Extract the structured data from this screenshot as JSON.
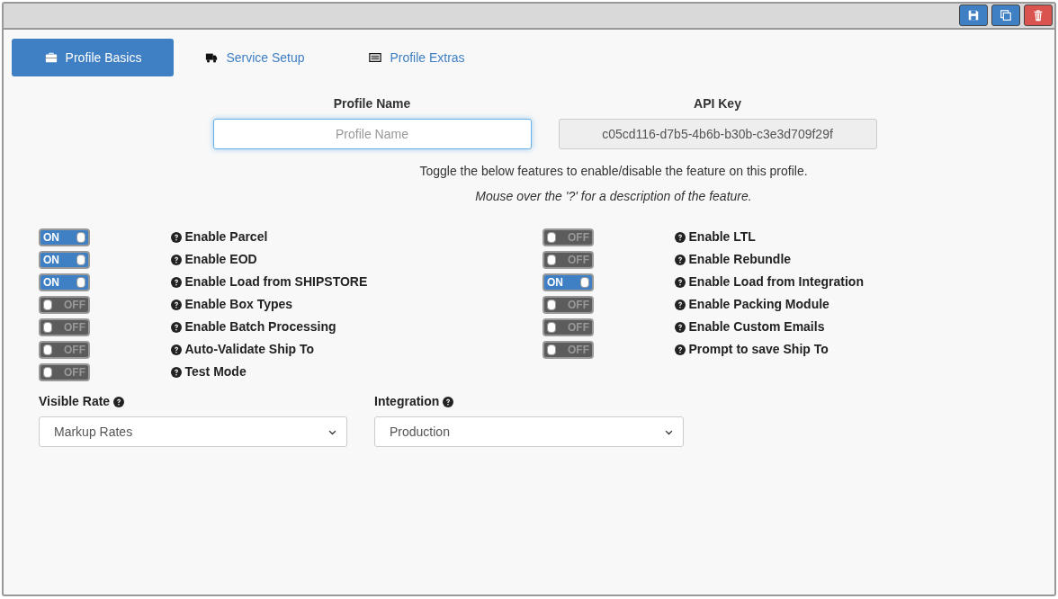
{
  "toolbar": {
    "buttons": [
      {
        "kind": "save",
        "color": "#3f7fc4"
      },
      {
        "kind": "copy",
        "color": "#3f7fc4"
      },
      {
        "kind": "delete",
        "color": "#d9534f"
      }
    ]
  },
  "tabs": [
    {
      "label": "Profile Basics",
      "kind": "basics",
      "selected": true
    },
    {
      "label": "Service Setup",
      "kind": "service",
      "selected": false
    },
    {
      "label": "Profile Extras",
      "kind": "extras",
      "selected": false
    }
  ],
  "profile_name": {
    "label": "Profile Name",
    "placeholder": "Profile Name",
    "focused": true
  },
  "api_key": {
    "label": "API Key",
    "value": "c05cd116-d7b5-4b6b-b30b-c3e3d709f29f",
    "disabled": true
  },
  "intro": "Toggle the below features to enable/disable the feature on this profile.",
  "hint": "Mouse over the '?' for a description of the feature.",
  "features_left": [
    {
      "label": "Enable Parcel",
      "on": true,
      "text": "ON"
    },
    {
      "label": "Enable EOD",
      "on": true,
      "text": "ON"
    },
    {
      "label": "Enable Load from SHIPSTORE",
      "on": true,
      "text": "ON"
    },
    {
      "label": "Enable Box Types",
      "on": false,
      "text": "OFF"
    },
    {
      "label": "Enable Batch Processing",
      "on": false,
      "text": "OFF"
    },
    {
      "label": "Auto-Validate Ship To",
      "on": false,
      "text": "OFF"
    },
    {
      "label": "Test Mode",
      "on": false,
      "text": "OFF"
    }
  ],
  "features_right": [
    {
      "label": "Enable LTL",
      "on": false,
      "text": "OFF"
    },
    {
      "label": "Enable Rebundle",
      "on": false,
      "text": "OFF"
    },
    {
      "label": "Enable Load from Integration",
      "on": true,
      "text": "ON"
    },
    {
      "label": "Enable Packing Module",
      "on": false,
      "text": "OFF"
    },
    {
      "label": "Enable Custom Emails",
      "on": false,
      "text": "OFF"
    },
    {
      "label": "Prompt to save Ship To",
      "on": false,
      "text": "OFF"
    }
  ],
  "selects": [
    {
      "label": "Visible Rate",
      "value": "Markup Rates"
    },
    {
      "label": "Integration",
      "value": "Production"
    }
  ]
}
